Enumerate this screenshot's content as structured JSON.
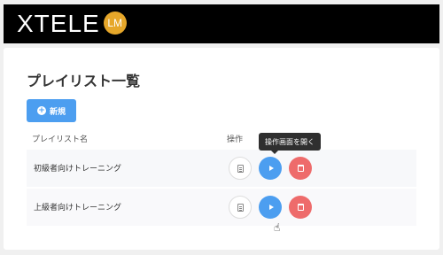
{
  "header": {
    "logo_text": "XTELE",
    "logo_badge": "LM"
  },
  "page": {
    "title": "プレイリスト一覧",
    "new_button_label": "新規"
  },
  "table": {
    "columns": [
      "プレイリスト名",
      "操作"
    ],
    "rows": [
      {
        "name": "初級者向けトレーニング"
      },
      {
        "name": "上級者向けトレーニング"
      }
    ]
  },
  "tooltip": {
    "text": "操作画面を開く"
  },
  "icons": {
    "doc": "document-icon",
    "play": "play-icon",
    "delete": "trash-icon"
  },
  "colors": {
    "primary": "#4c9ef0",
    "danger": "#ee6b6b",
    "badge": "#e6a72a"
  }
}
